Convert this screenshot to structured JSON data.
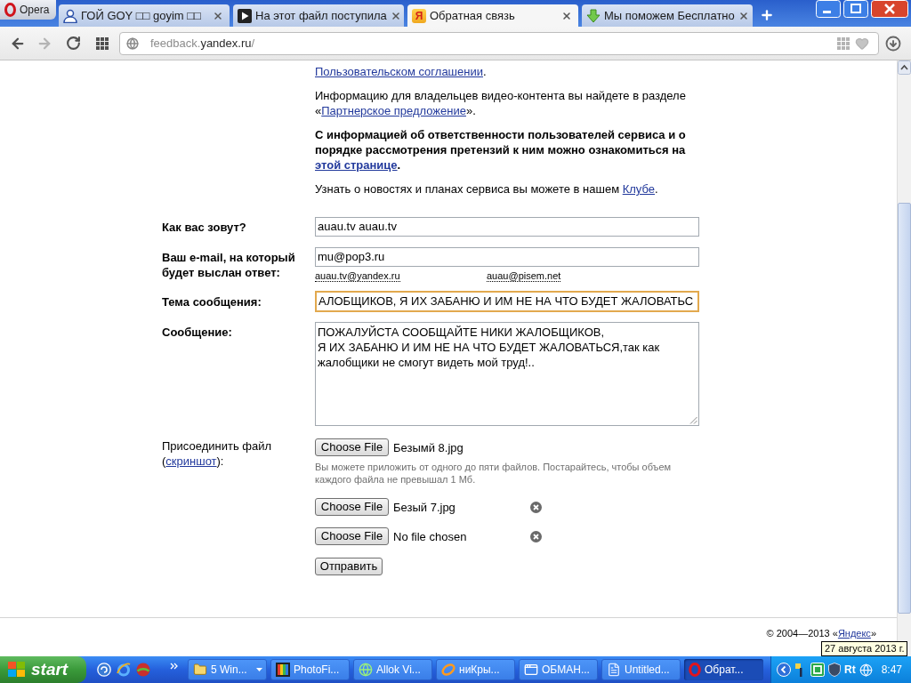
{
  "browser": {
    "menu_button": "Opera",
    "tabs": [
      {
        "title": "ГОЙ GOY □□ goyim □□",
        "selected": false
      },
      {
        "title": "На этот файл поступила",
        "selected": false
      },
      {
        "title": "Обратная связь",
        "selected": true,
        "icon_letter": "Я"
      },
      {
        "title": "Мы поможем Бесплатно",
        "selected": false
      }
    ],
    "navigation": {
      "back": {
        "disabled": false
      },
      "forward": {
        "disabled": true
      }
    },
    "address_bar": {
      "url": [
        {
          "text": "feedback.",
          "emphasis": false
        },
        {
          "text": "yandex.ru",
          "emphasis": true
        },
        {
          "text": "/",
          "emphasis": false
        }
      ]
    }
  },
  "page": {
    "info_paragraphs": [
      {
        "bold": false,
        "parts": [
          {
            "text": "Пользовательском соглашении",
            "link": true
          },
          {
            "text": ".",
            "link": false
          }
        ]
      },
      {
        "bold": false,
        "parts": [
          {
            "text": "Информацию для владельцев видео-контента вы найдете в разделе «",
            "link": false
          },
          {
            "text": "Партнерское предложение",
            "link": true
          },
          {
            "text": "».",
            "link": false
          }
        ]
      },
      {
        "bold": true,
        "parts": [
          {
            "text": "С информацией об ответственности пользователей сервиса и о порядке рассмотрения претензий к ним можно ознакомиться на ",
            "link": false
          },
          {
            "text": "этой странице",
            "link": true
          },
          {
            "text": ".",
            "link": false
          }
        ]
      },
      {
        "bold": false,
        "parts": [
          {
            "text": "Узнать о новостях и планах сервиса вы можете в нашем ",
            "link": false
          },
          {
            "text": "Клубе",
            "link": true
          },
          {
            "text": ".",
            "link": false
          }
        ]
      }
    ],
    "form": {
      "name": {
        "label": "Как вас зовут?",
        "value": "auau.tv auau.tv"
      },
      "email": {
        "label": "Ваш e-mail, на который будет выслан ответ:",
        "value": "mu@pop3.ru",
        "suggestions": [
          "auau.tv@yandex.ru",
          "auau@pisem.net"
        ]
      },
      "subject": {
        "label": "Тема сообщения:",
        "value": "АЛОБЩИКОВ, Я ИХ ЗАБАНЮ И ИМ НЕ НА ЧТО БУДЕТ ЖАЛОВАТЬС",
        "focused": true
      },
      "message": {
        "label": "Сообщение:",
        "value": "ПОЖАЛУЙСТА СООБЩАЙТЕ НИКИ ЖАЛОБЩИКОВ,\nЯ ИХ ЗАБАНЮ И ИМ НЕ НА ЧТО БУДЕТ ЖАЛОВАТЬСЯ,так как жалобщики не смогут видеть мой труд!.."
      },
      "attachments": {
        "label": [
          {
            "text": "Присоединить файл (",
            "link": false
          },
          {
            "text": "скриншот",
            "link": true
          },
          {
            "text": "):",
            "link": false
          }
        ],
        "files": [
          {
            "button": "Choose File",
            "file_name": "Безымй 8.jpg",
            "removable": false
          },
          {
            "button": "Choose File",
            "file_name": "Безый 7.jpg",
            "removable": true
          },
          {
            "button": "Choose File",
            "file_name": "No file chosen",
            "removable": true
          }
        ],
        "hint": "Вы можете приложить от одного до пяти файлов. Постарайтесь, чтобы объем каждого файла не превышал 1 Мб."
      },
      "submit": "Отправить"
    },
    "footer": {
      "copyright": [
        {
          "text": "© 2004—2013 «",
          "link": false
        },
        {
          "text": "Яндекс",
          "link": true
        },
        {
          "text": "»",
          "link": false
        }
      ]
    }
  },
  "tooltip": "27 августа 2013 г.",
  "taskbar": {
    "start": "start",
    "tasks": [
      {
        "label": "5 Win...",
        "selected": false,
        "kind": "group"
      },
      {
        "label": "PhotoFi...",
        "selected": false,
        "kind": "window"
      },
      {
        "label": "Allok Vi...",
        "selected": false,
        "kind": "window"
      },
      {
        "label": "ниКры...",
        "selected": false,
        "kind": "window"
      },
      {
        "label": "ОБМАН...",
        "selected": false,
        "kind": "window"
      },
      {
        "label": "Untitled...",
        "selected": false,
        "kind": "window"
      },
      {
        "label": "Обрат...",
        "selected": true,
        "kind": "window"
      }
    ],
    "tray": {
      "label": "Rt",
      "clock": "8:47"
    }
  }
}
